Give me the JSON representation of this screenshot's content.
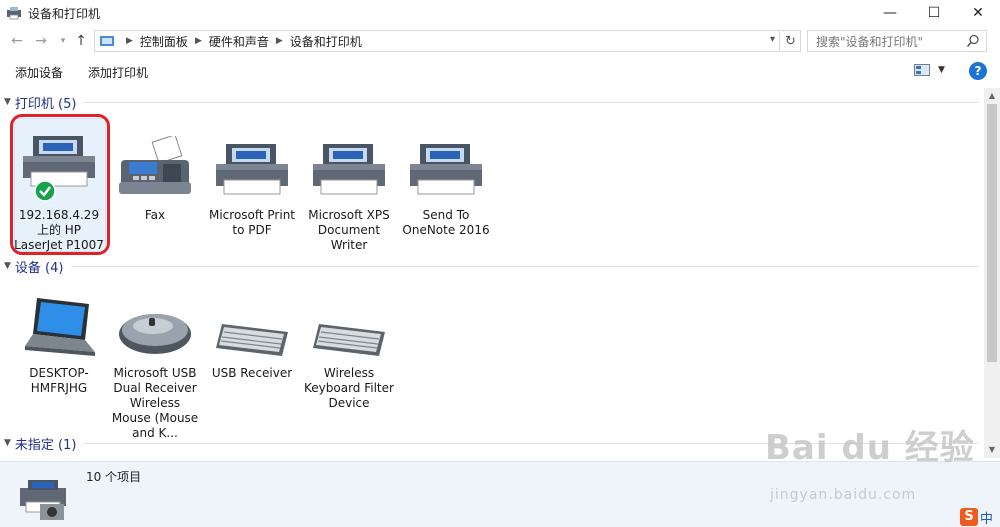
{
  "window": {
    "title": "设备和打印机",
    "minimize_glyph": "—",
    "maximize_glyph": "☐",
    "close_glyph": "✕"
  },
  "address": {
    "breadcrumbs": [
      "控制面板",
      "硬件和声音",
      "设备和打印机"
    ],
    "search_placeholder": "搜索\"设备和打印机\""
  },
  "commands": {
    "add_device": "添加设备",
    "add_printer": "添加打印机",
    "help": "?"
  },
  "groups": {
    "printers": {
      "title": "打印机 (5)",
      "items": [
        {
          "label": "192.168.4.29 上的 HP LaserJet P1007",
          "icon": "printer-icon",
          "default": true
        },
        {
          "label": "Fax",
          "icon": "fax-icon"
        },
        {
          "label": "Microsoft Print to PDF",
          "icon": "printer-icon"
        },
        {
          "label": "Microsoft XPS Document Writer",
          "icon": "printer-icon"
        },
        {
          "label": "Send To OneNote 2016",
          "icon": "printer-icon"
        }
      ]
    },
    "devices": {
      "title": "设备 (4)",
      "items": [
        {
          "label": "DESKTOP-HMFRJHG",
          "icon": "laptop-icon"
        },
        {
          "label": "Microsoft USB Dual Receiver Wireless Mouse (Mouse and K...",
          "icon": "mouse-icon"
        },
        {
          "label": "USB Receiver",
          "icon": "keyboard-icon"
        },
        {
          "label": "Wireless Keyboard Filter Device",
          "icon": "keyboard-icon"
        }
      ]
    },
    "unspecified": {
      "title": "未指定 (1)"
    }
  },
  "status": {
    "count": "10 个项目"
  },
  "watermark": {
    "brand": "Bai du 经验",
    "url": "jingyan.baidu.com"
  },
  "ime": {
    "badge": "S",
    "lang": "中"
  },
  "colors": {
    "group_title": "#1e3287",
    "selection_outline": "#e0202a",
    "help_blue": "#1c73d3",
    "status_bg": "#eff4fb"
  }
}
